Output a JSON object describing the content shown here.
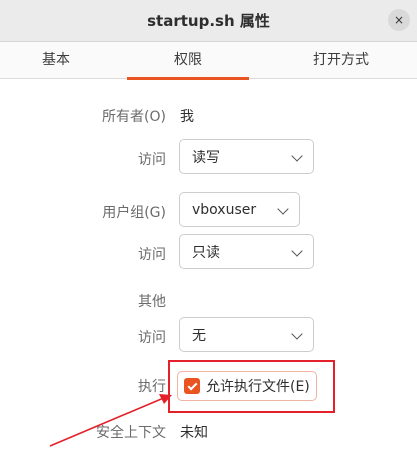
{
  "window": {
    "title": "startup.sh 属性",
    "close_icon": "×"
  },
  "tabs": [
    {
      "label": "基本",
      "active": false
    },
    {
      "label": "权限",
      "active": true
    },
    {
      "label": "打开方式",
      "active": false
    }
  ],
  "owner": {
    "label": "所有者(O)",
    "value": "我"
  },
  "owner_access": {
    "label": "访问",
    "value": "读写"
  },
  "group": {
    "label": "用户组(G)",
    "value": "vboxuser"
  },
  "group_access": {
    "label": "访问",
    "value": "只读"
  },
  "others": {
    "label": "其他"
  },
  "others_access": {
    "label": "访问",
    "value": "无"
  },
  "execute": {
    "label": "执行",
    "checkbox_label": "允许执行文件(E)",
    "checked": true
  },
  "security_context": {
    "label": "安全上下文",
    "value": "未知"
  },
  "colors": {
    "accent": "#e95420",
    "annotation_red": "#e4202a"
  }
}
